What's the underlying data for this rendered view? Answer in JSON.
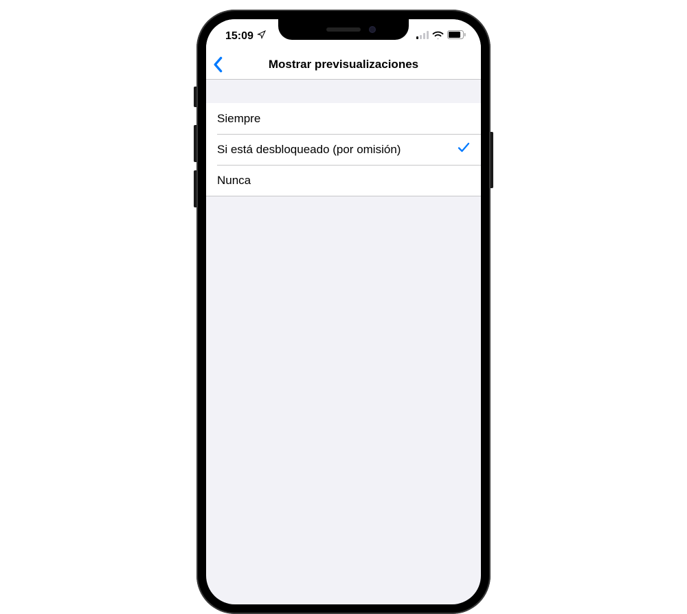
{
  "status": {
    "time": "15:09"
  },
  "nav": {
    "title": "Mostrar previsualizaciones"
  },
  "options": [
    {
      "label": "Siempre",
      "selected": false
    },
    {
      "label": "Si está desbloqueado (por omisión)",
      "selected": true
    },
    {
      "label": "Nunca",
      "selected": false
    }
  ]
}
